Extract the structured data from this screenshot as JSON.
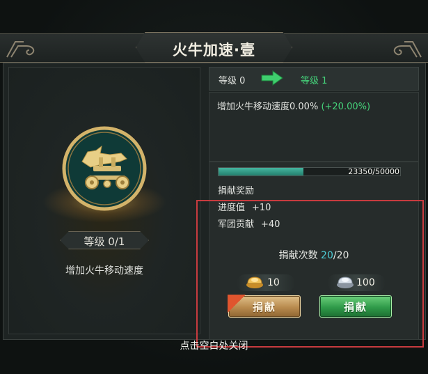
{
  "window": {
    "title": "火牛加速·壹"
  },
  "skill": {
    "level_badge": "等级 0/1",
    "description": "增加火牛移动速度",
    "emblem_icon": "fire-ox-cart-icon"
  },
  "upgrade": {
    "current_level": "等级 0",
    "next_level": "等级 1",
    "effect_label": "增加火牛移动速度0.00% ",
    "effect_bonus": "(+20.00%)"
  },
  "progress": {
    "current": 23350,
    "max": 50000,
    "text": "23350/50000"
  },
  "rewards": {
    "title": "捐献奖励",
    "items": [
      {
        "label": "进度值",
        "value": "+10"
      },
      {
        "label": "军团贡献",
        "value": "+40"
      }
    ]
  },
  "donate": {
    "count_label": "捐献次数 ",
    "count_current": "20",
    "count_max": "/20",
    "options": [
      {
        "cost": "10",
        "currency_icon": "gold-ingot-icon",
        "button_label": "捐献",
        "style": "gold"
      },
      {
        "cost": "100",
        "currency_icon": "silver-ingot-icon",
        "button_label": "捐献",
        "style": "green"
      }
    ]
  },
  "footer": {
    "close_hint": "点击空白处关闭"
  },
  "colors": {
    "accent_green": "#45d37a",
    "accent_cyan": "#4ecdd6",
    "highlight_red": "#c83b3f",
    "progress_fill": "#2f9e88"
  }
}
